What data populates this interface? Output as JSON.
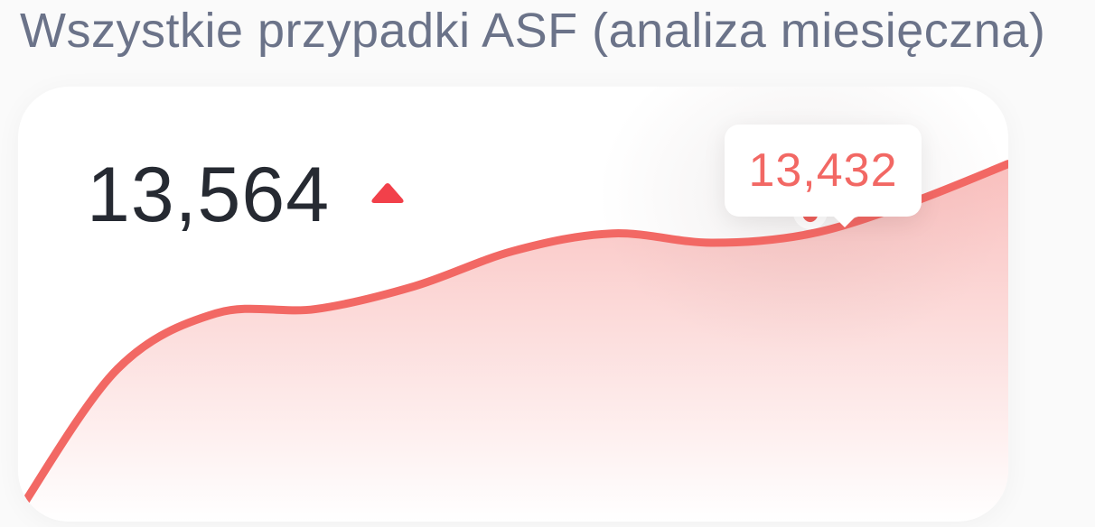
{
  "page": {
    "title": "Wszystkie przypadki ASF (analiza miesięczna)"
  },
  "summary": {
    "total": "13,564",
    "trend_icon": "trend-up-triangle-icon",
    "trend_direction": "up"
  },
  "tooltip": {
    "value": "13,432"
  },
  "colors": {
    "accent": "#f26864",
    "title": "#6b7389",
    "value": "#262a32"
  },
  "chart_data": {
    "type": "area",
    "title": "Wszystkie przypadki ASF (analiza miesięczna)",
    "x": [
      0,
      1,
      2,
      3,
      4,
      5,
      6,
      7,
      8,
      9,
      10
    ],
    "values": [
      0,
      6900,
      9600,
      9800,
      10900,
      12600,
      13450,
      13000,
      13432,
      14900,
      16800
    ],
    "highlight_index": 8,
    "ylim": [
      0,
      20000
    ],
    "grid": false,
    "legend": "none"
  }
}
